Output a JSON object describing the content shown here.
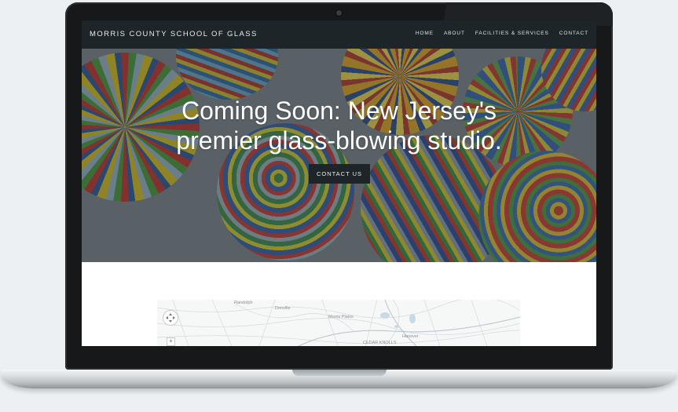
{
  "site": {
    "brand": "Morris County School of Glass",
    "nav": [
      {
        "label": "Home"
      },
      {
        "label": "About"
      },
      {
        "label": "Facilities & Services"
      },
      {
        "label": "Contact"
      }
    ]
  },
  "hero": {
    "title_line1": "Coming Soon: New Jersey's",
    "title_line2": "premier glass-blowing studio.",
    "cta_label": "Contact Us"
  },
  "map": {
    "labels": [
      "Randolph",
      "Morris Plains",
      "Hanover",
      "Denville",
      "CEDAR KNOLLS"
    ],
    "zoom_in": "+"
  },
  "colors": {
    "nav_bg": "#1e2528",
    "button_bg": "#1d2528",
    "hero_overlay": "#283034"
  }
}
